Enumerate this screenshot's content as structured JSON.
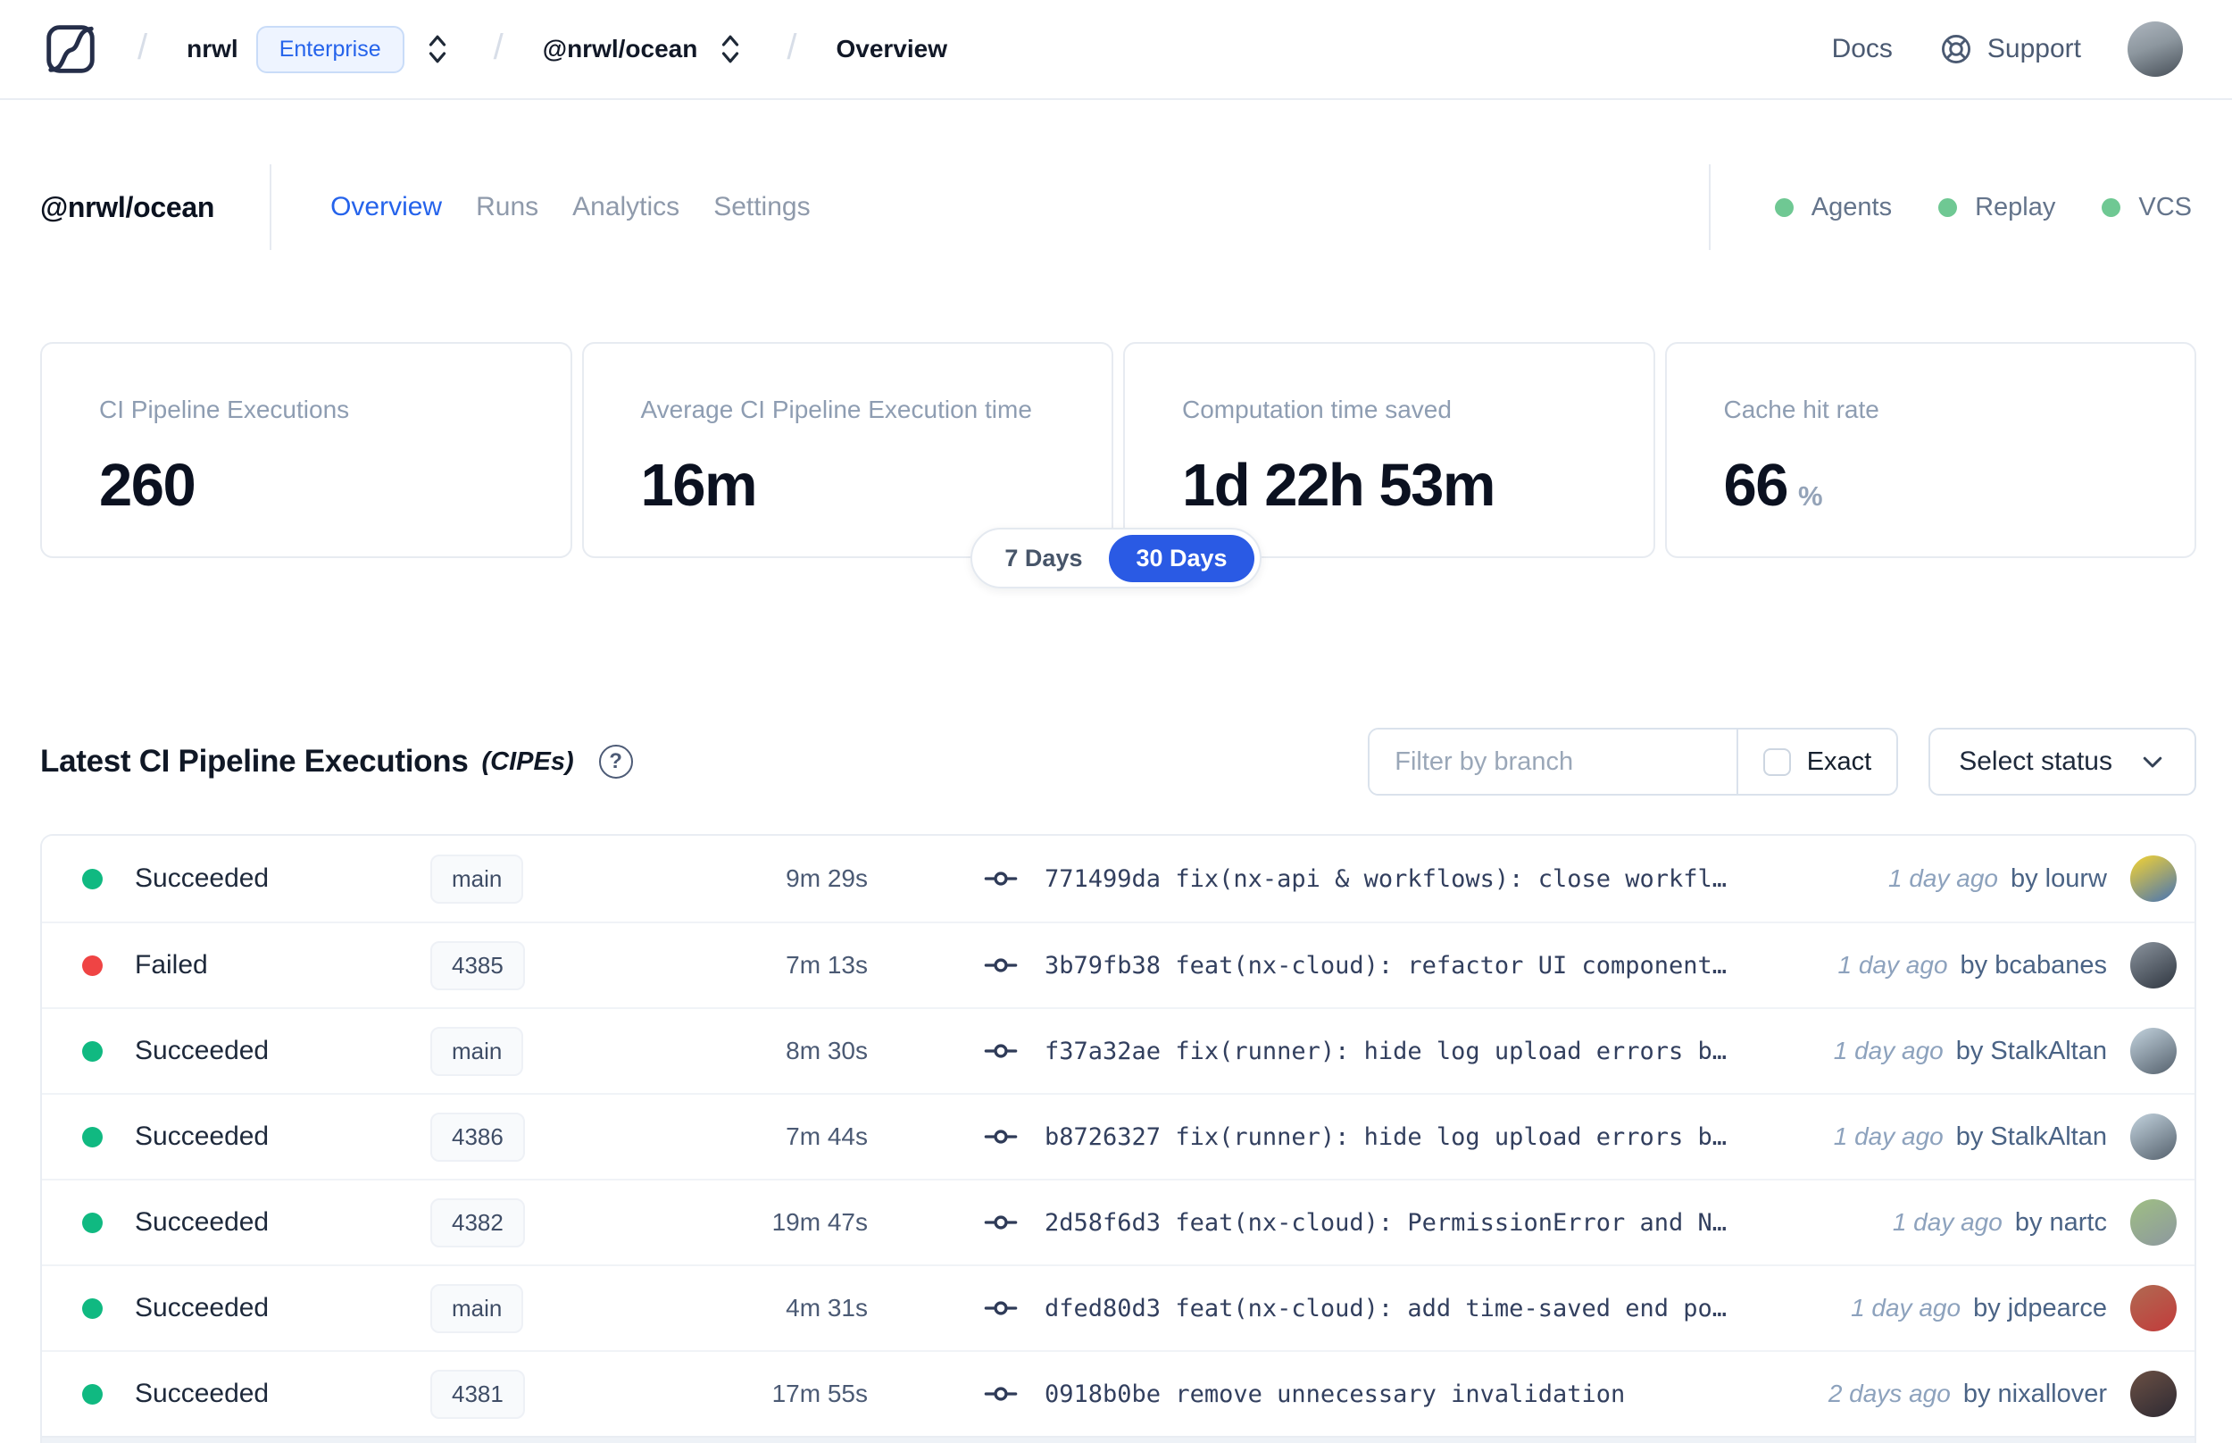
{
  "colors": {
    "accent_blue": "#2563eb",
    "success_green": "#10b981",
    "failed_red": "#ef4444",
    "feature_green": "#6fc893"
  },
  "topbar": {
    "org": "nrwl",
    "org_badge": "Enterprise",
    "workspace": "@nrwl/ocean",
    "page": "Overview",
    "docs_label": "Docs",
    "support_label": "Support"
  },
  "header": {
    "title": "@nrwl/ocean",
    "tabs": [
      {
        "label": "Overview",
        "active": true
      },
      {
        "label": "Runs",
        "active": false
      },
      {
        "label": "Analytics",
        "active": false
      },
      {
        "label": "Settings",
        "active": false
      }
    ],
    "features": [
      {
        "label": "Agents"
      },
      {
        "label": "Replay"
      },
      {
        "label": "VCS"
      }
    ]
  },
  "stats": {
    "cards": [
      {
        "label": "CI Pipeline Executions",
        "value": "260",
        "suffix": ""
      },
      {
        "label": "Average CI Pipeline Execution time",
        "value": "16m",
        "suffix": ""
      },
      {
        "label": "Computation time saved",
        "value": "1d 22h 53m",
        "suffix": ""
      },
      {
        "label": "Cache hit rate",
        "value": "66",
        "suffix": "%"
      }
    ],
    "toggle": {
      "options": [
        "7 Days",
        "30 Days"
      ],
      "selected": "30 Days"
    }
  },
  "cipe_section": {
    "title": "Latest CI Pipeline Executions",
    "subtitle": "(CIPEs)",
    "help_glyph": "?",
    "filter_placeholder": "Filter by branch",
    "exact_label": "Exact",
    "select_status_label": "Select status"
  },
  "table": {
    "rows": [
      {
        "status": "Succeeded",
        "branch": "main",
        "duration": "9m 29s",
        "commit_hash": "771499da",
        "commit_message": "fix(nx-api & workflows): close workfl…",
        "time_ago": "1 day ago",
        "author": "by lourw",
        "avatar": {
          "from": "#f6d431",
          "to": "#4673b5"
        }
      },
      {
        "status": "Failed",
        "branch": "4385",
        "duration": "7m 13s",
        "commit_hash": "3b79fb38",
        "commit_message": "feat(nx-cloud): refactor UI component…",
        "time_ago": "1 day ago",
        "author": "by bcabanes",
        "avatar": {
          "from": "#8b949e",
          "to": "#2f3640"
        }
      },
      {
        "status": "Succeeded",
        "branch": "main",
        "duration": "8m 30s",
        "commit_hash": "f37a32ae",
        "commit_message": "fix(runner): hide log upload errors b…",
        "time_ago": "1 day ago",
        "author": "by StalkAltan",
        "avatar": {
          "from": "#c3d3de",
          "to": "#55616d"
        }
      },
      {
        "status": "Succeeded",
        "branch": "4386",
        "duration": "7m 44s",
        "commit_hash": "b8726327",
        "commit_message": "fix(runner): hide log upload errors b…",
        "time_ago": "1 day ago",
        "author": "by StalkAltan",
        "avatar": {
          "from": "#c3d3de",
          "to": "#55616d"
        }
      },
      {
        "status": "Succeeded",
        "branch": "4382",
        "duration": "19m 47s",
        "commit_hash": "2d58f6d3",
        "commit_message": "feat(nx-cloud): PermissionError and N…",
        "time_ago": "1 day ago",
        "author": "by nartc",
        "avatar": {
          "from": "#9fbf83",
          "to": "#8d989f"
        }
      },
      {
        "status": "Succeeded",
        "branch": "main",
        "duration": "4m 31s",
        "commit_hash": "dfed80d3",
        "commit_message": "feat(nx-cloud): add time-saved end po…",
        "time_ago": "1 day ago",
        "author": "by jdpearce",
        "avatar": {
          "from": "#b06a52",
          "to": "#c23b3b"
        }
      },
      {
        "status": "Succeeded",
        "branch": "4381",
        "duration": "17m 55s",
        "commit_hash": "0918b0be",
        "commit_message": "remove unnecessary invalidation",
        "time_ago": "2 days ago",
        "author": "by nixallover",
        "avatar": {
          "from": "#6b5044",
          "to": "#2e2a33"
        }
      }
    ]
  }
}
